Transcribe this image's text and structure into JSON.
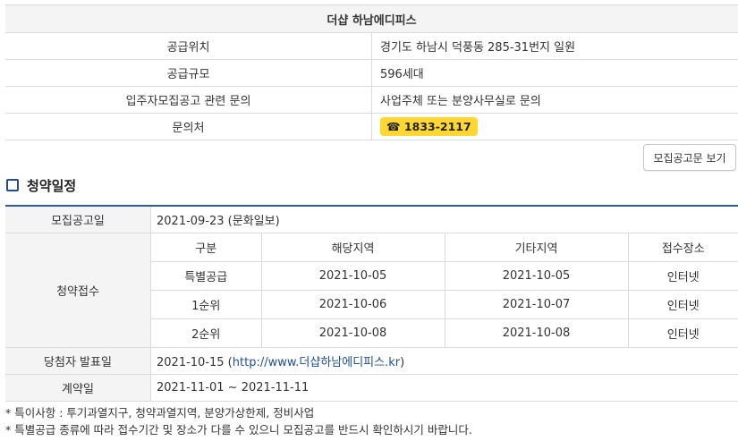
{
  "complex": {
    "name": "더샵 하남에디피스",
    "rows": [
      {
        "label": "공급위치",
        "value": "경기도 하남시 덕풍동 285-31번지 일원"
      },
      {
        "label": "공급규모",
        "value": "596세대"
      },
      {
        "label": "입주자모집공고 관련 문의",
        "value": "사업주체 또는 분양사무실로 문의"
      }
    ],
    "contact_label": "문의처",
    "contact_phone": "☎ 1833-2117"
  },
  "notice_button": "모집공고문 보기",
  "section_title": "청약일정",
  "schedule": {
    "announce_label": "모집공고일",
    "announce_value": "2021-09-23 (문화일보)",
    "receipt_label": "청약접수",
    "receipt_headers": [
      "구분",
      "해당지역",
      "기타지역",
      "접수장소"
    ],
    "receipt_rows": [
      [
        "특별공급",
        "2021-10-05",
        "2021-10-05",
        "인터넷"
      ],
      [
        "1순위",
        "2021-10-06",
        "2021-10-07",
        "인터넷"
      ],
      [
        "2순위",
        "2021-10-08",
        "2021-10-08",
        "인터넷"
      ]
    ],
    "winner_label": "당첨자 발표일",
    "winner_date": "2021-10-15 (",
    "winner_url": "http://www.더샵하남에디피스.kr",
    "winner_close": ")",
    "contract_label": "계약일",
    "contract_value": "2021-11-01 ~ 2021-11-11"
  },
  "notes": [
    "* 특이사항 : 투기과열지구, 청약과열지역, 분양가상한제, 정비사업",
    "* 특별공급 종류에 따라 접수기간 및 장소가 다를 수 있으니 모집공고를 반드시 확인하시기 바랍니다."
  ],
  "colors": {
    "accent": "#2b5cab",
    "badge": "#ffd730",
    "link": "#1f4e9c"
  },
  "icons": {
    "phone": "phone-icon",
    "section": "section-square-icon"
  }
}
